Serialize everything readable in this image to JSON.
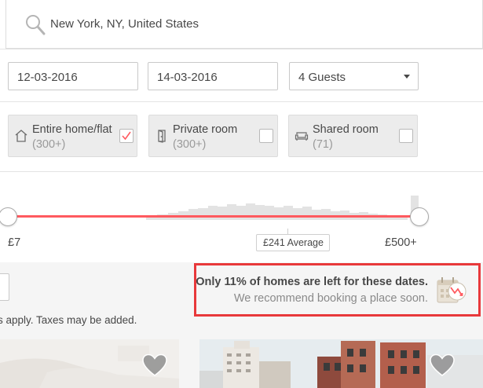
{
  "search": {
    "location": "New York, NY, United States"
  },
  "dates": {
    "checkin": "12-03-2016",
    "checkout": "14-03-2016"
  },
  "guests": {
    "selected": "4 Guests"
  },
  "room_types": [
    {
      "label": "Entire home/flat",
      "count": "(300+)",
      "checked": true,
      "icon": "home-icon"
    },
    {
      "label": "Private room",
      "count": "(300+)",
      "checked": false,
      "icon": "door-icon"
    },
    {
      "label": "Shared room",
      "count": "(71)",
      "checked": false,
      "icon": "couch-icon"
    }
  ],
  "price": {
    "min_label": "£7",
    "max_label": "£500+",
    "average_label": "£241 Average",
    "min": 7,
    "max": 500,
    "average": 241
  },
  "notice": {
    "title": "Only 11% of homes are left for these dates.",
    "subtitle": "We recommend booking a place soon.",
    "icon": "calendar-trend-icon",
    "highlight_color": "#e8393b"
  },
  "disclaimer": "s apply. Taxes may be added.",
  "colors": {
    "accent": "#ff5a5f",
    "text": "#484848",
    "muted": "#9a9a9a"
  }
}
